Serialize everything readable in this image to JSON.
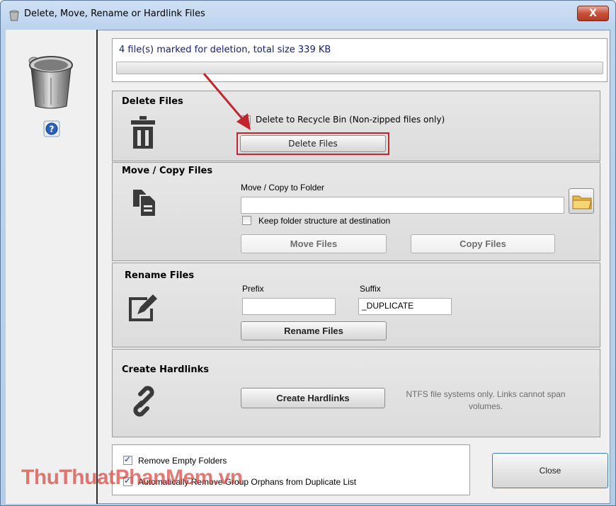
{
  "window": {
    "title": "Delete, Move, Rename or Hardlink Files",
    "close_glyph": "X"
  },
  "status": {
    "text": "4 file(s) marked for deletion, total size 339 KB",
    "progress": 0
  },
  "delete_section": {
    "heading": "Delete Files",
    "recycle_label": "Delete to Recycle Bin (Non-zipped files only)",
    "recycle_checked": true,
    "button": "Delete Files",
    "icon": "trash-icon"
  },
  "move_section": {
    "heading": "Move / Copy Files",
    "folder_label": "Move / Copy to Folder",
    "folder_value": "",
    "keep_structure_label": "Keep folder structure at destination",
    "keep_structure_checked": false,
    "move_button": "Move Files",
    "copy_button": "Copy Files",
    "icon": "copy-files-icon"
  },
  "rename_section": {
    "heading": "Rename Files",
    "prefix_label": "Prefix",
    "prefix_value": "",
    "suffix_label": "Suffix",
    "suffix_value": "_DUPLICATE",
    "button": "Rename Files",
    "icon": "rename-edit-icon"
  },
  "hardlink_section": {
    "heading": "Create Hardlinks",
    "button": "Create Hardlinks",
    "note": "NTFS file systems only.  Links cannot span volumes.",
    "icon": "link-chain-icon"
  },
  "options": {
    "remove_empty_label": "Remove Empty Folders",
    "remove_empty_checked": true,
    "auto_remove_label": "Automatically Remove Group Orphans from Duplicate List",
    "auto_remove_checked": true
  },
  "close_button": "Close",
  "watermark": "ThuThuatPhanMem.vn",
  "colors": {
    "accent_red": "#c0262b",
    "status_text": "#16216b"
  }
}
